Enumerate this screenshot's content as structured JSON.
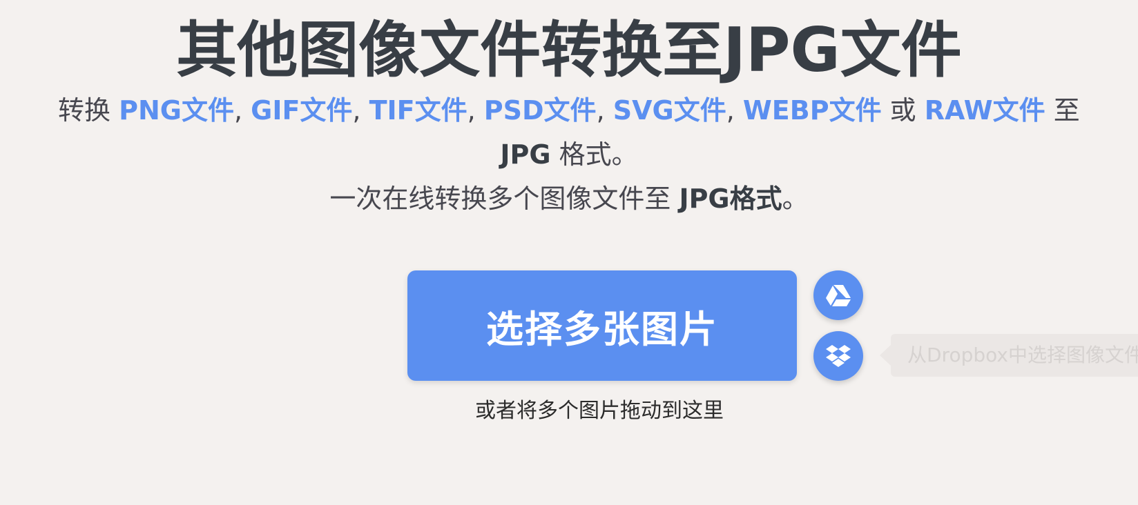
{
  "header": {
    "title": "其他图像文件转换至JPG文件"
  },
  "intro": {
    "prefix": "转换 ",
    "formats": [
      "PNG文件",
      "GIF文件",
      "TIF文件",
      "PSD文件",
      "SVG文件",
      "WEBP文件"
    ],
    "separator": ", ",
    "or_word": " 或 ",
    "last_format": "RAW文件",
    "suffix": " 至",
    "line2_bold": "JPG",
    "line2_rest": " 格式。",
    "line3_text": "一次在线转换多个图像文件至 ",
    "line3_bold": "JPG格式",
    "line3_end": "。"
  },
  "upload": {
    "button_label": "选择多张图片",
    "drop_hint": "或者将多个图片拖动到这里",
    "gdrive_icon": "google-drive-icon",
    "dropbox_icon": "dropbox-icon",
    "dropbox_tooltip": "从Dropbox中选择图像文件"
  },
  "colors": {
    "accent": "#5b8ff0",
    "text": "#383e45",
    "background": "#f4f1ef"
  }
}
